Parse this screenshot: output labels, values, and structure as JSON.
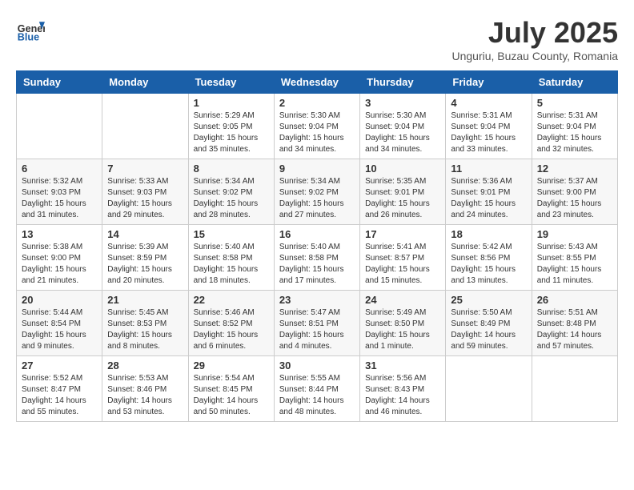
{
  "header": {
    "logo_general": "General",
    "logo_blue": "Blue",
    "month_title": "July 2025",
    "location": "Unguriu, Buzau County, Romania"
  },
  "weekdays": [
    "Sunday",
    "Monday",
    "Tuesday",
    "Wednesday",
    "Thursday",
    "Friday",
    "Saturday"
  ],
  "weeks": [
    [
      {
        "day": "",
        "info": ""
      },
      {
        "day": "",
        "info": ""
      },
      {
        "day": "1",
        "info": "Sunrise: 5:29 AM\nSunset: 9:05 PM\nDaylight: 15 hours\nand 35 minutes."
      },
      {
        "day": "2",
        "info": "Sunrise: 5:30 AM\nSunset: 9:04 PM\nDaylight: 15 hours\nand 34 minutes."
      },
      {
        "day": "3",
        "info": "Sunrise: 5:30 AM\nSunset: 9:04 PM\nDaylight: 15 hours\nand 34 minutes."
      },
      {
        "day": "4",
        "info": "Sunrise: 5:31 AM\nSunset: 9:04 PM\nDaylight: 15 hours\nand 33 minutes."
      },
      {
        "day": "5",
        "info": "Sunrise: 5:31 AM\nSunset: 9:04 PM\nDaylight: 15 hours\nand 32 minutes."
      }
    ],
    [
      {
        "day": "6",
        "info": "Sunrise: 5:32 AM\nSunset: 9:03 PM\nDaylight: 15 hours\nand 31 minutes."
      },
      {
        "day": "7",
        "info": "Sunrise: 5:33 AM\nSunset: 9:03 PM\nDaylight: 15 hours\nand 29 minutes."
      },
      {
        "day": "8",
        "info": "Sunrise: 5:34 AM\nSunset: 9:02 PM\nDaylight: 15 hours\nand 28 minutes."
      },
      {
        "day": "9",
        "info": "Sunrise: 5:34 AM\nSunset: 9:02 PM\nDaylight: 15 hours\nand 27 minutes."
      },
      {
        "day": "10",
        "info": "Sunrise: 5:35 AM\nSunset: 9:01 PM\nDaylight: 15 hours\nand 26 minutes."
      },
      {
        "day": "11",
        "info": "Sunrise: 5:36 AM\nSunset: 9:01 PM\nDaylight: 15 hours\nand 24 minutes."
      },
      {
        "day": "12",
        "info": "Sunrise: 5:37 AM\nSunset: 9:00 PM\nDaylight: 15 hours\nand 23 minutes."
      }
    ],
    [
      {
        "day": "13",
        "info": "Sunrise: 5:38 AM\nSunset: 9:00 PM\nDaylight: 15 hours\nand 21 minutes."
      },
      {
        "day": "14",
        "info": "Sunrise: 5:39 AM\nSunset: 8:59 PM\nDaylight: 15 hours\nand 20 minutes."
      },
      {
        "day": "15",
        "info": "Sunrise: 5:40 AM\nSunset: 8:58 PM\nDaylight: 15 hours\nand 18 minutes."
      },
      {
        "day": "16",
        "info": "Sunrise: 5:40 AM\nSunset: 8:58 PM\nDaylight: 15 hours\nand 17 minutes."
      },
      {
        "day": "17",
        "info": "Sunrise: 5:41 AM\nSunset: 8:57 PM\nDaylight: 15 hours\nand 15 minutes."
      },
      {
        "day": "18",
        "info": "Sunrise: 5:42 AM\nSunset: 8:56 PM\nDaylight: 15 hours\nand 13 minutes."
      },
      {
        "day": "19",
        "info": "Sunrise: 5:43 AM\nSunset: 8:55 PM\nDaylight: 15 hours\nand 11 minutes."
      }
    ],
    [
      {
        "day": "20",
        "info": "Sunrise: 5:44 AM\nSunset: 8:54 PM\nDaylight: 15 hours\nand 9 minutes."
      },
      {
        "day": "21",
        "info": "Sunrise: 5:45 AM\nSunset: 8:53 PM\nDaylight: 15 hours\nand 8 minutes."
      },
      {
        "day": "22",
        "info": "Sunrise: 5:46 AM\nSunset: 8:52 PM\nDaylight: 15 hours\nand 6 minutes."
      },
      {
        "day": "23",
        "info": "Sunrise: 5:47 AM\nSunset: 8:51 PM\nDaylight: 15 hours\nand 4 minutes."
      },
      {
        "day": "24",
        "info": "Sunrise: 5:49 AM\nSunset: 8:50 PM\nDaylight: 15 hours\nand 1 minute."
      },
      {
        "day": "25",
        "info": "Sunrise: 5:50 AM\nSunset: 8:49 PM\nDaylight: 14 hours\nand 59 minutes."
      },
      {
        "day": "26",
        "info": "Sunrise: 5:51 AM\nSunset: 8:48 PM\nDaylight: 14 hours\nand 57 minutes."
      }
    ],
    [
      {
        "day": "27",
        "info": "Sunrise: 5:52 AM\nSunset: 8:47 PM\nDaylight: 14 hours\nand 55 minutes."
      },
      {
        "day": "28",
        "info": "Sunrise: 5:53 AM\nSunset: 8:46 PM\nDaylight: 14 hours\nand 53 minutes."
      },
      {
        "day": "29",
        "info": "Sunrise: 5:54 AM\nSunset: 8:45 PM\nDaylight: 14 hours\nand 50 minutes."
      },
      {
        "day": "30",
        "info": "Sunrise: 5:55 AM\nSunset: 8:44 PM\nDaylight: 14 hours\nand 48 minutes."
      },
      {
        "day": "31",
        "info": "Sunrise: 5:56 AM\nSunset: 8:43 PM\nDaylight: 14 hours\nand 46 minutes."
      },
      {
        "day": "",
        "info": ""
      },
      {
        "day": "",
        "info": ""
      }
    ]
  ]
}
